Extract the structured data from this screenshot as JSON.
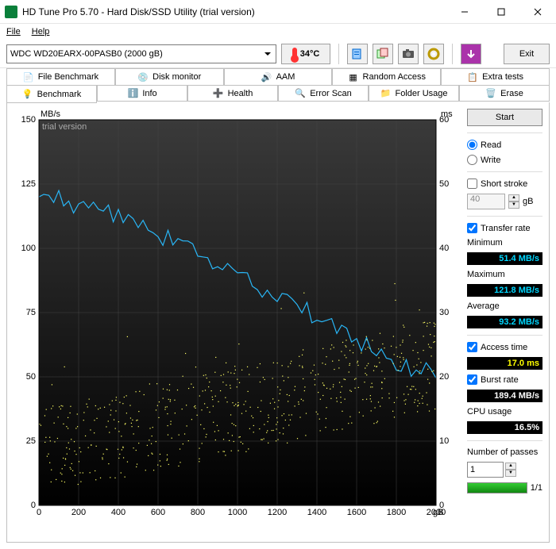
{
  "window": {
    "title": "HD Tune Pro 5.70 - Hard Disk/SSD Utility (trial version)"
  },
  "menu": {
    "file": "File",
    "help": "Help"
  },
  "toolbar": {
    "drive": "WDC WD20EARX-00PASB0 (2000 gB)",
    "temp": "34°C",
    "exit": "Exit"
  },
  "tabs_top": [
    {
      "label": "File Benchmark"
    },
    {
      "label": "Disk monitor"
    },
    {
      "label": "AAM"
    },
    {
      "label": "Random Access"
    },
    {
      "label": "Extra tests"
    }
  ],
  "tabs_bottom": [
    {
      "label": "Benchmark"
    },
    {
      "label": "Info"
    },
    {
      "label": "Health"
    },
    {
      "label": "Error Scan"
    },
    {
      "label": "Folder Usage"
    },
    {
      "label": "Erase"
    }
  ],
  "chart": {
    "y_left_label": "MB/s",
    "y_right_label": "ms",
    "x_label": "gB",
    "x_max": 2000,
    "watermark": "trial version"
  },
  "chart_data": {
    "type": "line+scatter",
    "xlabel": "gB",
    "y_left": {
      "label": "MB/s",
      "range": [
        0,
        150
      ],
      "ticks": [
        0,
        25,
        50,
        75,
        100,
        125,
        150
      ]
    },
    "y_right": {
      "label": "ms",
      "range": [
        0,
        60
      ],
      "ticks": [
        0,
        10,
        20,
        30,
        40,
        50,
        60
      ]
    },
    "x": {
      "range": [
        0,
        2000
      ],
      "ticks": [
        0,
        200,
        400,
        600,
        800,
        1000,
        1200,
        1400,
        1600,
        1800,
        2000
      ],
      "unit": "gB"
    },
    "series": [
      {
        "name": "Transfer rate (MB/s)",
        "axis": "left",
        "type": "line",
        "color": "#29b6f6",
        "points": [
          [
            0,
            120
          ],
          [
            50,
            119
          ],
          [
            100,
            121
          ],
          [
            150,
            118
          ],
          [
            200,
            119
          ],
          [
            250,
            117
          ],
          [
            300,
            116
          ],
          [
            350,
            115
          ],
          [
            400,
            114
          ],
          [
            450,
            112
          ],
          [
            500,
            110
          ],
          [
            550,
            108
          ],
          [
            600,
            106
          ],
          [
            650,
            105
          ],
          [
            700,
            103
          ],
          [
            750,
            101
          ],
          [
            800,
            99
          ],
          [
            850,
            97
          ],
          [
            900,
            95
          ],
          [
            950,
            92
          ],
          [
            1000,
            90
          ],
          [
            1050,
            88
          ],
          [
            1100,
            86
          ],
          [
            1150,
            84
          ],
          [
            1200,
            82
          ],
          [
            1250,
            80
          ],
          [
            1300,
            78
          ],
          [
            1350,
            76
          ],
          [
            1400,
            74
          ],
          [
            1450,
            72
          ],
          [
            1500,
            70
          ],
          [
            1550,
            67
          ],
          [
            1600,
            65
          ],
          [
            1650,
            62
          ],
          [
            1700,
            60
          ],
          [
            1750,
            57
          ],
          [
            1800,
            56
          ],
          [
            1850,
            55
          ],
          [
            1900,
            53
          ],
          [
            1950,
            52
          ],
          [
            2000,
            51
          ]
        ]
      },
      {
        "name": "Access time (ms)",
        "axis": "right",
        "type": "scatter",
        "color": "#ffff66",
        "approx_mean_ms": 17.0,
        "approx_range_ms": [
          5,
          32
        ]
      }
    ]
  },
  "panel": {
    "start": "Start",
    "read": "Read",
    "write": "Write",
    "short_stroke": "Short stroke",
    "stroke_val": "40",
    "stroke_unit": "gB",
    "transfer_rate": "Transfer rate",
    "minimum_label": "Minimum",
    "minimum_val": "51.4 MB/s",
    "maximum_label": "Maximum",
    "maximum_val": "121.8 MB/s",
    "average_label": "Average",
    "average_val": "93.2 MB/s",
    "access_time": "Access time",
    "access_val": "17.0 ms",
    "burst_rate": "Burst rate",
    "burst_val": "189.4 MB/s",
    "cpu_label": "CPU usage",
    "cpu_val": "16.5%",
    "passes_label": "Number of passes",
    "passes_val": "1",
    "passes_progress": "1/1"
  }
}
